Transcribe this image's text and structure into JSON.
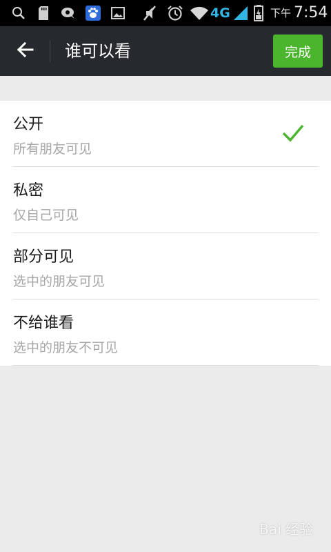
{
  "status_bar": {
    "time_prefix": "下午",
    "time": "7:54",
    "network": "4G",
    "icons": [
      "search-icon",
      "sd-card-icon",
      "notification-icon",
      "baidu-app-icon",
      "image-icon",
      "mute-icon",
      "alarm-icon",
      "wifi-icon",
      "signal-icon",
      "battery-icon"
    ]
  },
  "header": {
    "title": "谁可以看",
    "done_label": "完成"
  },
  "options": [
    {
      "title": "公开",
      "subtitle": "所有朋友可见",
      "selected": true
    },
    {
      "title": "私密",
      "subtitle": "仅自己可见",
      "selected": false
    },
    {
      "title": "部分可见",
      "subtitle": "选中的朋友可见",
      "selected": false
    },
    {
      "title": "不给谁看",
      "subtitle": "选中的朋友不可见",
      "selected": false
    }
  ],
  "watermark": {
    "text": "Bai 经验"
  },
  "colors": {
    "accent": "#4bb52d",
    "titlebar": "#262a2e",
    "background": "#ebebeb",
    "subtitle": "#a6a6a6"
  }
}
